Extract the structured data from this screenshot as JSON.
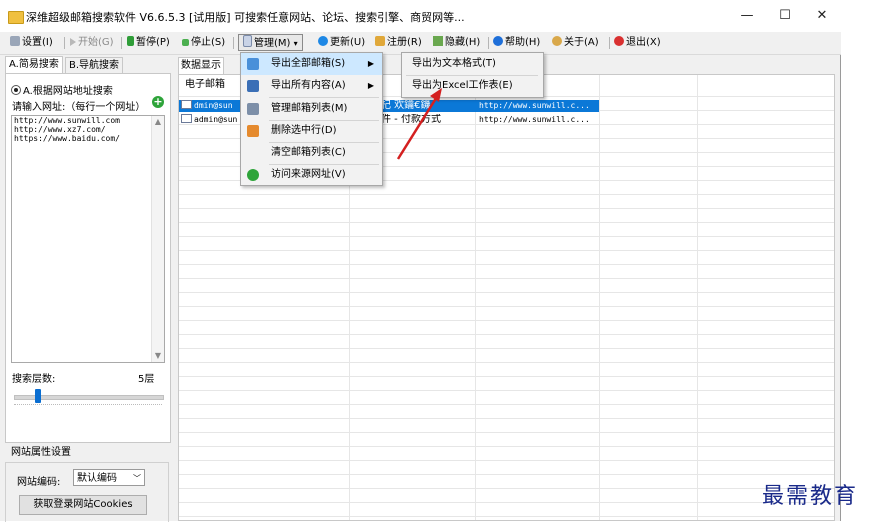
{
  "window": {
    "title": "深维超级邮箱搜索软件 V6.6.5.3 [试用版] 可搜索任意网站、论坛、搜索引擎、商贸网等...",
    "min_glyph": "—",
    "max_glyph": "☐",
    "close_glyph": "✕"
  },
  "toolbar": {
    "settings": "设置(I)",
    "start": "开始(G)",
    "pause": "暂停(P)",
    "stop": "停止(S)",
    "manage": "管理(M)",
    "update": "更新(U)",
    "register": "注册(R)",
    "hide": "隐藏(H)",
    "help": "帮助(H)",
    "about": "关于(A)",
    "exit": "退出(X)"
  },
  "left": {
    "tab_simple": "A.简易搜索",
    "tab_nav": "B.导航搜索",
    "radio_label": "A.根据网站地址搜索",
    "url_prompt": "请输入网址:（每行一个网址）",
    "urls": [
      "http://www.sunwill.com",
      "http://www.xz7.com/",
      "https://www.baidu.com/"
    ],
    "depth_label": "搜索层数:",
    "depth_value": "5层",
    "depth_level": 0.15,
    "site_group_title": "网站属性设置",
    "encoding_label": "网站编码:",
    "encoding_value": "默认编码",
    "cookie_button": "获取登录网站Cookies"
  },
  "right": {
    "tab_label": "数据显示",
    "col_email": "电子邮箱",
    "rows": [
      {
        "email": "dmin@sun",
        "info": "杞  欢鑰€鐖",
        "url": "http://www.sunwill.c...",
        "selected": true
      },
      {
        "email": "admin@sun",
        "info": "件 - 付款方式",
        "url": "http://www.sunwill.c...",
        "selected": false
      }
    ]
  },
  "menu": {
    "items": [
      {
        "label": "导出全部邮箱(S)",
        "submenu": true,
        "highlight": true
      },
      {
        "label": "导出所有内容(A)",
        "submenu": true
      },
      {
        "label": "管理邮箱列表(M)",
        "submenu": false
      },
      {
        "label": "删除选中行(D)",
        "submenu": false
      },
      {
        "label": "清空邮箱列表(C)",
        "submenu": false
      },
      {
        "label": "访问来源网址(V)",
        "submenu": false
      }
    ],
    "submenu": [
      "导出为文本格式(T)",
      "导出为Excel工作表(E)"
    ]
  },
  "watermark": "最需教育",
  "colors": {
    "selection": "#0b78d7",
    "arrow": "#d42020",
    "menu_highlight": "#cde8ff"
  }
}
